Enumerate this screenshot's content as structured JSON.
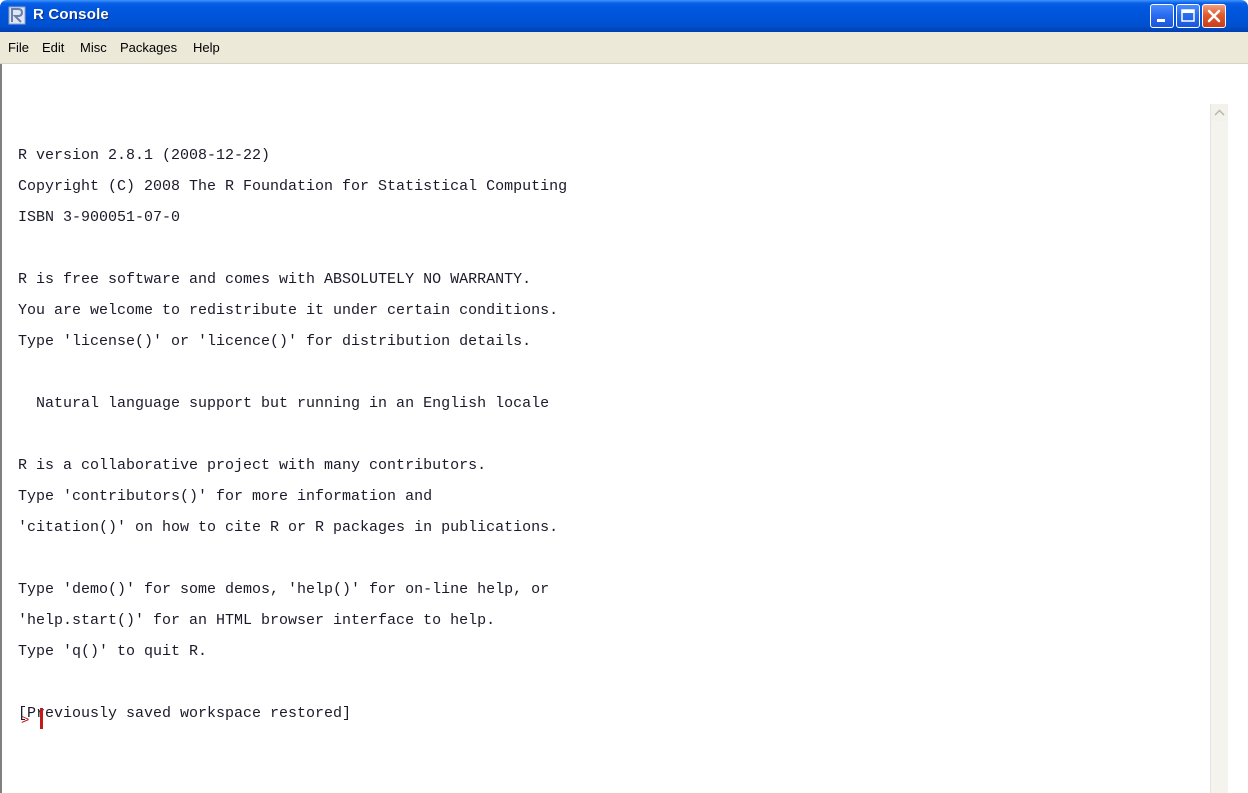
{
  "window": {
    "title": "R Console",
    "app_icon": "r-logo-icon",
    "controls": [
      "minimize-icon",
      "maximize-icon",
      "close-icon"
    ]
  },
  "menu": {
    "items": [
      {
        "label": "File"
      },
      {
        "label": "Edit"
      },
      {
        "label": "Misc"
      },
      {
        "label": "Packages"
      },
      {
        "label": "Help"
      }
    ]
  },
  "console": {
    "lines": [
      "R version 2.8.1 (2008-12-22)",
      "Copyright (C) 2008 The R Foundation for Statistical Computing",
      "ISBN 3-900051-07-0",
      "",
      "R is free software and comes with ABSOLUTELY NO WARRANTY.",
      "You are welcome to redistribute it under certain conditions.",
      "Type 'license()' or 'licence()' for distribution details.",
      "",
      "  Natural language support but running in an English locale",
      "",
      "R is a collaborative project with many contributors.",
      "Type 'contributors()' for more information and",
      "'citation()' on how to cite R or R packages in publications.",
      "",
      "Type 'demo()' for some demos, 'help()' for on-line help, or",
      "'help.start()' for an HTML browser interface to help.",
      "Type 'q()' to quit R.",
      "",
      "[Previously saved workspace restored]"
    ],
    "prompt": ">",
    "input_value": ""
  },
  "colors": {
    "titlebar": "#0054da",
    "menubar": "#ece9d8",
    "console_text": "#1a1a2a",
    "prompt": "#c41a1a"
  }
}
